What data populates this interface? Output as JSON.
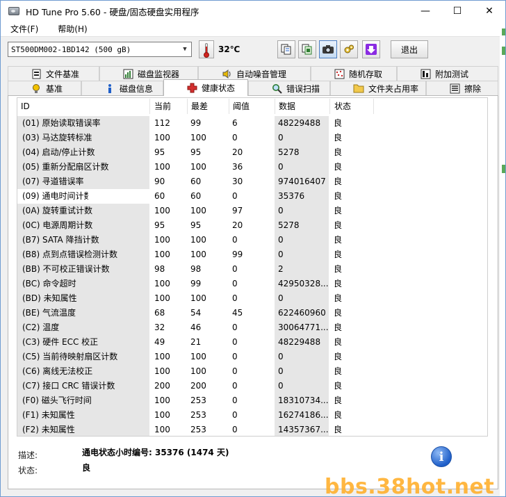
{
  "window": {
    "title": "HD Tune Pro 5.60 - 硬盘/固态硬盘实用程序",
    "controls": {
      "minimize": "—",
      "maximize": "☐",
      "close": "✕"
    }
  },
  "menu": [
    "文件(F)",
    "帮助(H)"
  ],
  "toolbar": {
    "drive": "ST500DM002-1BD142 (500 gB)",
    "temperature": "32℃",
    "exit_label": "退出",
    "icons": [
      "copy-info-icon",
      "copy-screen-icon",
      "screenshot-icon",
      "options-icon",
      "save-icon"
    ]
  },
  "tabs": {
    "row1": [
      "文件基准",
      "磁盘监视器",
      "自动噪音管理",
      "随机存取",
      "附加测试"
    ],
    "row2": [
      "基准",
      "磁盘信息",
      "健康状态",
      "错误扫描",
      "文件夹占用率",
      "擦除"
    ],
    "selected": "健康状态"
  },
  "health": {
    "columns": [
      "ID",
      "当前",
      "最差",
      "阈值",
      "数据",
      "状态"
    ],
    "rows": [
      [
        "(01) 原始读取错误率",
        "112",
        "99",
        "6",
        "48229488",
        "良"
      ],
      [
        "(03) 马达旋转标准",
        "100",
        "100",
        "0",
        "0",
        "良"
      ],
      [
        "(04) 启动/停止计数",
        "95",
        "95",
        "20",
        "5278",
        "良"
      ],
      [
        "(05) 重新分配扇区计数",
        "100",
        "100",
        "36",
        "0",
        "良"
      ],
      [
        "(07) 寻道错误率",
        "90",
        "60",
        "30",
        "974016407",
        "良"
      ],
      [
        "(09) 通电时间计数",
        "60",
        "60",
        "0",
        "35376",
        "良"
      ],
      [
        "(0A) 旋转重试计数",
        "100",
        "100",
        "97",
        "0",
        "良"
      ],
      [
        "(0C) 电源周期计数",
        "95",
        "95",
        "20",
        "5278",
        "良"
      ],
      [
        "(B7) SATA 降挡计数",
        "100",
        "100",
        "0",
        "0",
        "良"
      ],
      [
        "(B8) 点到点错误检测计数",
        "100",
        "100",
        "99",
        "0",
        "良"
      ],
      [
        "(BB) 不可校正错误计数",
        "98",
        "98",
        "0",
        "2",
        "良"
      ],
      [
        "(BC) 命令超时",
        "100",
        "99",
        "0",
        "42950328...",
        "良"
      ],
      [
        "(BD) 未知属性",
        "100",
        "100",
        "0",
        "0",
        "良"
      ],
      [
        "(BE) 气流温度",
        "68",
        "54",
        "45",
        "622460960",
        "良"
      ],
      [
        "(C2) 温度",
        "32",
        "46",
        "0",
        "30064771...",
        "良"
      ],
      [
        "(C3) 硬件 ECC 校正",
        "49",
        "21",
        "0",
        "48229488",
        "良"
      ],
      [
        "(C5) 当前待映射扇区计数",
        "100",
        "100",
        "0",
        "0",
        "良"
      ],
      [
        "(C6) 离线无法校正",
        "100",
        "100",
        "0",
        "0",
        "良"
      ],
      [
        "(C7) 接口 CRC 错误计数",
        "200",
        "200",
        "0",
        "0",
        "良"
      ],
      [
        "(F0) 磁头飞行时间",
        "100",
        "253",
        "0",
        "18310734...",
        "良"
      ],
      [
        "(F1) 未知属性",
        "100",
        "253",
        "0",
        "16274186...",
        "良"
      ],
      [
        "(F2) 未知属性",
        "100",
        "253",
        "0",
        "14357367...",
        "良"
      ]
    ]
  },
  "description": {
    "desc_label": "描述:",
    "desc_value": "通电状态小时编号: 35376 (1474 天)",
    "status_label": "状态:",
    "status_value": "良",
    "info_glyph": "i"
  },
  "watermark": "bbs.38hot.net",
  "colors": {
    "selected_tab": "#ffffff",
    "column_shade": "#e6e6e6",
    "watermark": "#ffb02e"
  }
}
